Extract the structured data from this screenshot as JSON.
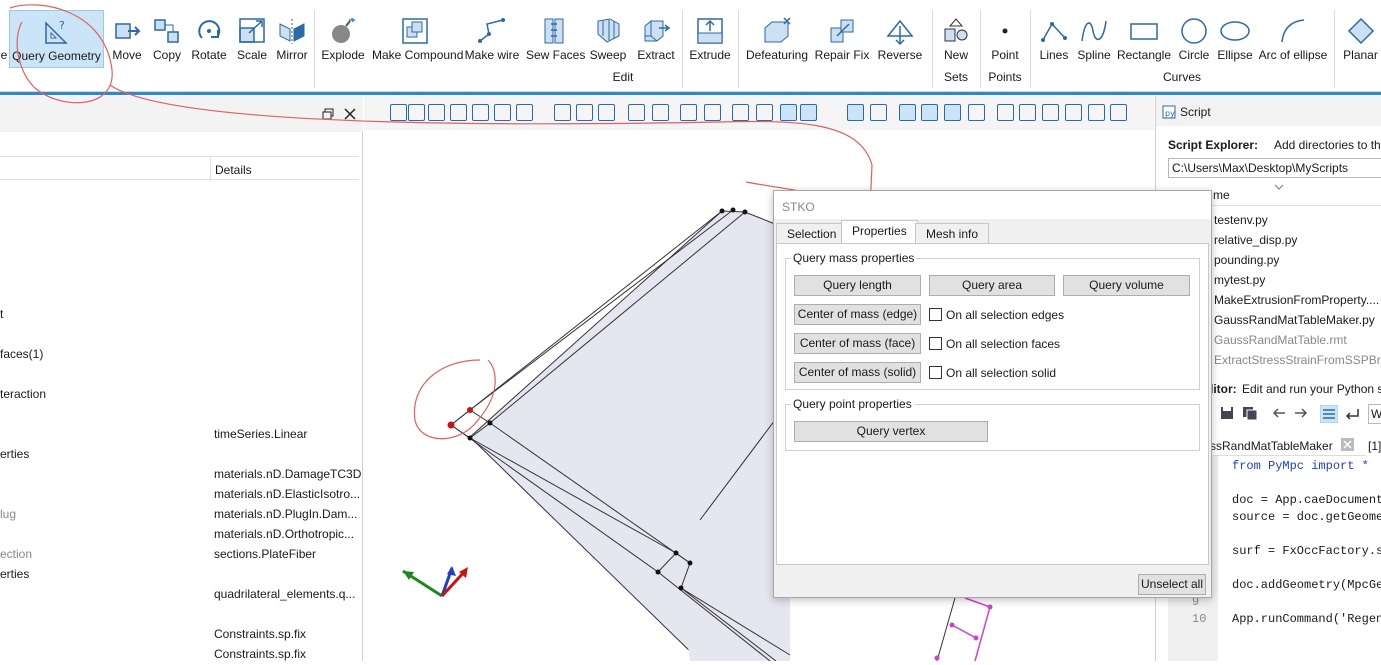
{
  "ribbon": {
    "buttons": [
      {
        "id": "e",
        "label": "e"
      },
      {
        "id": "query-geometry",
        "label": "Query Geometry"
      },
      {
        "id": "move",
        "label": "Move"
      },
      {
        "id": "copy",
        "label": "Copy"
      },
      {
        "id": "rotate",
        "label": "Rotate"
      },
      {
        "id": "scale",
        "label": "Scale"
      },
      {
        "id": "mirror",
        "label": "Mirror"
      },
      {
        "id": "explode",
        "label": "Explode"
      },
      {
        "id": "make-compound",
        "label": "Make Compound"
      },
      {
        "id": "make-wire",
        "label": "Make wire"
      },
      {
        "id": "sew-faces",
        "label": "Sew Faces"
      },
      {
        "id": "sweep",
        "label": "Sweep"
      },
      {
        "id": "extract",
        "label": "Extract"
      },
      {
        "id": "extrude",
        "label": "Extrude"
      },
      {
        "id": "defeaturing",
        "label": "Defeaturing"
      },
      {
        "id": "repair-fix",
        "label": "Repair Fix"
      },
      {
        "id": "reverse",
        "label": "Reverse"
      },
      {
        "id": "new",
        "label": "New"
      },
      {
        "id": "point",
        "label": "Point"
      },
      {
        "id": "lines",
        "label": "Lines"
      },
      {
        "id": "spline",
        "label": "Spline"
      },
      {
        "id": "rectangle",
        "label": "Rectangle"
      },
      {
        "id": "circle",
        "label": "Circle"
      },
      {
        "id": "ellipse",
        "label": "Ellipse"
      },
      {
        "id": "arc-of-ellipse",
        "label": "Arc of ellipse"
      },
      {
        "id": "planar",
        "label": "Planar"
      }
    ],
    "groups": {
      "edit": "Edit",
      "sets": "Sets",
      "points": "Points",
      "curves": "Curves"
    }
  },
  "left_panel": {
    "column_header": "Details",
    "rows": [
      {
        "name": "t",
        "details": ""
      },
      {
        "name": "faces(1)",
        "details": ""
      },
      {
        "name": "teraction",
        "details": ""
      },
      {
        "name": "",
        "details": "timeSeries.Linear"
      },
      {
        "name": "erties",
        "details": ""
      },
      {
        "name": "",
        "details": "materials.nD.DamageTC3D"
      },
      {
        "name": "",
        "details": "materials.nD.ElasticIsotro..."
      },
      {
        "name": "lug",
        "details": "materials.nD.PlugIn.Dam..."
      },
      {
        "name": "",
        "details": "materials.nD.Orthotropic..."
      },
      {
        "name": "ection",
        "details": "sections.PlateFiber"
      },
      {
        "name": "erties",
        "details": ""
      },
      {
        "name": "",
        "details": "quadrilateral_elements.q..."
      },
      {
        "name": "",
        "details": "Constraints.sp.fix"
      },
      {
        "name": "",
        "details": "Constraints.sp.fix"
      }
    ]
  },
  "script_panel": {
    "title": "Script",
    "explorer_label": "Script Explorer:",
    "explorer_desc": "Add directories to the sea",
    "path": "C:\\Users\\Max\\Desktop\\MyScripts",
    "files_header": "me",
    "files": [
      "testenv.py",
      "relative_disp.py",
      "pounding.py",
      "mytest.py",
      "MakeExtrusionFromProperty....",
      "GaussRandMatTableMaker.py",
      "GaussRandMatTable.rmt",
      "ExtractStressStrainFromSSPBr..."
    ],
    "editor_label": "ditor:",
    "editor_desc": "Edit and run your Python scri",
    "editor_tab": "ssRandMatTableMaker",
    "editor_tab_num": "[1]",
    "editor_combo": "Wi",
    "code_lines": [
      {
        "num": "",
        "text": "from PyMpc import *"
      },
      {
        "num": "",
        "text": ""
      },
      {
        "num": "",
        "text": "doc = App.caeDocument"
      },
      {
        "num": "",
        "text": "source = doc.getGeomet"
      },
      {
        "num": "",
        "text": ""
      },
      {
        "num": "",
        "text": "surf = FxOccFactory.su"
      },
      {
        "num": "",
        "text": ""
      },
      {
        "num": "",
        "text": "doc.addGeometry(MpcGeo"
      },
      {
        "num": "9",
        "text": ""
      },
      {
        "num": "10",
        "text": "App.runCommand('Regene"
      }
    ]
  },
  "dialog": {
    "title": "STKO",
    "tabs": [
      "Selection",
      "Properties",
      "Mesh info"
    ],
    "active_tab": "Properties",
    "mass_group_title": "Query mass properties",
    "buttons": {
      "query_length": "Query length",
      "query_area": "Query area",
      "query_volume": "Query volume",
      "com_edge": "Center of mass (edge)",
      "com_face": "Center of mass (face)",
      "com_solid": "Center of mass (solid)",
      "query_vertex": "Query vertex",
      "unselect_all": "Unselect all"
    },
    "checkboxes": {
      "edges": {
        "label": "On all selection edges",
        "checked": false
      },
      "faces": {
        "label": "On all selection faces",
        "checked": false
      },
      "solid": {
        "label": "On all selection solid",
        "checked": false
      }
    },
    "point_group_title": "Query point properties"
  },
  "colors": {
    "accent": "#2b88d8",
    "annotation": "#e06060",
    "face_fill": "#e6e6f0",
    "selected_vertex": "#cc1111",
    "mesh_magenta": "#d040d0"
  }
}
